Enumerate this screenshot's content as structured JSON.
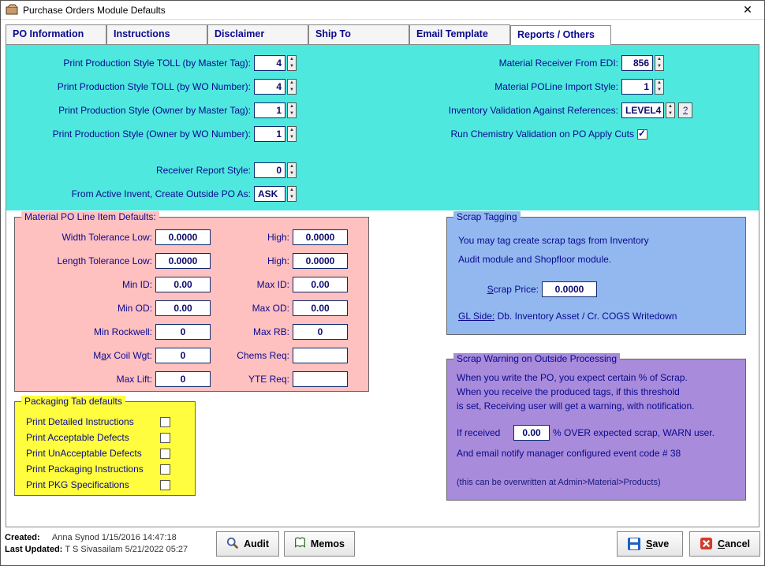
{
  "window": {
    "title": "Purchase Orders Module Defaults"
  },
  "tabs": {
    "items": [
      "PO Information",
      "Instructions",
      "Disclaimer",
      "Ship To",
      "Email Template",
      "Reports / Others"
    ],
    "active": 5
  },
  "top": {
    "left": {
      "prodTollMaster": {
        "label": "Print Production Style TOLL (by Master Tag):",
        "value": "4"
      },
      "prodTollWO": {
        "label": "Print Production Style TOLL (by WO Number):",
        "value": "4"
      },
      "prodOwnerMaster": {
        "label": "Print Production Style (Owner by Master Tag):",
        "value": "1"
      },
      "prodOwnerWO": {
        "label": "Print Production Style (Owner by WO Number):",
        "value": "1"
      },
      "receiverStyle": {
        "label": "Receiver Report Style:",
        "value": "0"
      },
      "createOutside": {
        "label": "From Active Invent, Create Outside PO As:",
        "value": "ASK"
      }
    },
    "right": {
      "matRecvEDI": {
        "label": "Material Receiver From EDI:",
        "value": "856"
      },
      "matPOImport": {
        "label": "Material POLine Import Style:",
        "value": "1"
      },
      "invValid": {
        "label": "Inventory Validation Against References:",
        "value": "LEVEL4"
      },
      "runChem": {
        "label": "Run Chemistry Validation on PO Apply Cuts",
        "checked": true
      }
    }
  },
  "matDefaults": {
    "title": "Material PO Line Item Defaults:",
    "widthLow": {
      "label": "Width Tolerance Low:",
      "value": "0.0000"
    },
    "widthHigh": {
      "label": "High:",
      "value": "0.0000"
    },
    "lenLow": {
      "label": "Length Tolerance Low:",
      "value": "0.0000"
    },
    "lenHigh": {
      "label": "High:",
      "value": "0.0000"
    },
    "minID": {
      "label": "Min ID:",
      "value": "0.00"
    },
    "maxID": {
      "label": "Max ID:",
      "value": "0.00"
    },
    "minOD": {
      "label": "Min OD:",
      "value": "0.00"
    },
    "maxOD": {
      "label": "Max OD:",
      "value": "0.00"
    },
    "minRock": {
      "label": "Min Rockwell:",
      "value": "0"
    },
    "maxRB": {
      "label": "Max RB:",
      "value": "0"
    },
    "maxCoil": {
      "label_pre": "M",
      "label_u": "a",
      "label_post": "x Coil Wgt:",
      "value": "0"
    },
    "chems": {
      "label": "Chems Req:",
      "value": ""
    },
    "maxLift": {
      "label": "Max Lift:",
      "value": "0"
    },
    "yte": {
      "label": "YTE Req:",
      "value": ""
    }
  },
  "packaging": {
    "title": "Packaging Tab defaults",
    "items": [
      "Print Detailed Instructions",
      "Print Acceptable Defects",
      "Print UnAcceptable Defects",
      "Print Packaging Instructions",
      "Print PKG Specifications"
    ],
    "checked": [
      false,
      false,
      false,
      false,
      false
    ]
  },
  "scrapTag": {
    "title": "Scrap Tagging",
    "line1": "You may tag create scrap tags from Inventory",
    "line2": "Audit module and Shopfloor module.",
    "priceLabel_u": "S",
    "priceLabel_rest": "crap Price:",
    "priceValue": "0.0000",
    "glside_pre": "GL Side:",
    "glside_rest": "  Db. Inventory Asset / Cr. COGS Writedown"
  },
  "scrapWarn": {
    "title": "Scrap Warning on Outside Processing",
    "p1": "When you write the PO, you expect certain % of Scrap.",
    "p2": "When you receive the produced tags, if this threshold",
    "p3": "is set, Receiving user will get a warning, with notification.",
    "ifrecv_pre": "If received",
    "ifrecv_val": "0.00",
    "ifrecv_post": "  % OVER expected scrap, WARN user.",
    "emailLine": "And email notify manager configured event code # 38",
    "footnote": "(this can be overwritten at Admin>Material>Products)"
  },
  "footer": {
    "createdLabel": "Created:",
    "createdVal": "Anna Synod 1/15/2016 14:47:18",
    "updatedLabel": "Last Updated:",
    "updatedVal": "T S Sivasailam 5/21/2022 05:27",
    "audit": "Audit",
    "memos": "Memos",
    "save_u": "S",
    "save_rest": "ave",
    "cancel_u": "C",
    "cancel_rest": "ancel"
  }
}
